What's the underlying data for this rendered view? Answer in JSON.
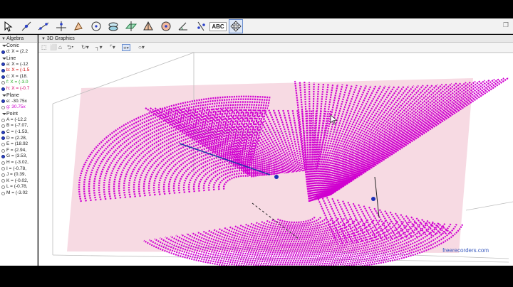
{
  "toolbar": {
    "tools": [
      {
        "icon": "move-arrow-icon",
        "selected": false
      },
      {
        "icon": "point-icon",
        "selected": false
      },
      {
        "icon": "line-icon",
        "selected": false
      },
      {
        "icon": "perpendicular-line-icon",
        "selected": false
      },
      {
        "icon": "polygon-icon",
        "selected": false
      },
      {
        "icon": "circle-icon",
        "selected": false
      },
      {
        "icon": "intersect-surfaces-icon",
        "selected": false
      },
      {
        "icon": "plane-icon",
        "selected": false
      },
      {
        "icon": "pyramid-icon",
        "selected": false
      },
      {
        "icon": "sphere-icon",
        "selected": false
      },
      {
        "icon": "angle-icon",
        "selected": false
      },
      {
        "icon": "reflect-icon",
        "selected": false
      },
      {
        "icon": "text-abc-icon",
        "label": "ABC",
        "selected": false
      },
      {
        "icon": "rotate-view-icon",
        "selected": true
      }
    ]
  },
  "algebra": {
    "title": "Algebra",
    "groups": [
      {
        "name": "Conic",
        "items": [
          {
            "text": "d: X = (2.2",
            "color": "#222222",
            "visible": true
          }
        ]
      },
      {
        "name": "Line",
        "items": [
          {
            "text": "a: X = (-12",
            "color": "#222222",
            "visible": true
          },
          {
            "text": "b: X = (-1.5",
            "color": "#cc0000",
            "visible": true
          },
          {
            "text": "c: X = (18.",
            "color": "#222222",
            "visible": true
          },
          {
            "text": "f: X = (-3.0",
            "color": "#22aa22",
            "visible": false
          },
          {
            "text": "h: X = (-0.7",
            "color": "#d4006a",
            "visible": true
          }
        ]
      },
      {
        "name": "Plane",
        "items": [
          {
            "text": "e: -30.75x",
            "color": "#222222",
            "visible": true
          },
          {
            "text": "g: 30.75x",
            "color": "#d000d0",
            "visible": false
          }
        ]
      },
      {
        "name": "Point",
        "items": [
          {
            "text": "A = (-12.2",
            "color": "#222222",
            "visible": false
          },
          {
            "text": "B = (-7.07,",
            "color": "#222222",
            "visible": false
          },
          {
            "text": "C = (-1.53,",
            "color": "#222222",
            "visible": true
          },
          {
            "text": "D = (2.28,",
            "color": "#222222",
            "visible": true
          },
          {
            "text": "E = (18.92",
            "color": "#222222",
            "visible": false
          },
          {
            "text": "F = (2.94,",
            "color": "#222222",
            "visible": false
          },
          {
            "text": "G = (3.53,",
            "color": "#222222",
            "visible": true
          },
          {
            "text": "H = (-3.02,",
            "color": "#222222",
            "visible": false
          },
          {
            "text": "I = (-0.78,",
            "color": "#222222",
            "visible": false
          },
          {
            "text": "J = (0.39,",
            "color": "#222222",
            "visible": false
          },
          {
            "text": "K = (-0.02,",
            "color": "#222222",
            "visible": false
          },
          {
            "text": "L = (-0.78,",
            "color": "#222222",
            "visible": false
          },
          {
            "text": "M = (-3.02",
            "color": "#222222",
            "visible": false
          }
        ]
      }
    ]
  },
  "view3d": {
    "title": "3D Graphics",
    "surface_color": "#d000d0",
    "plane_color": "#f6d6e0",
    "points": [
      "point-C",
      "point-G"
    ]
  },
  "watermark": "freerecorders.com"
}
